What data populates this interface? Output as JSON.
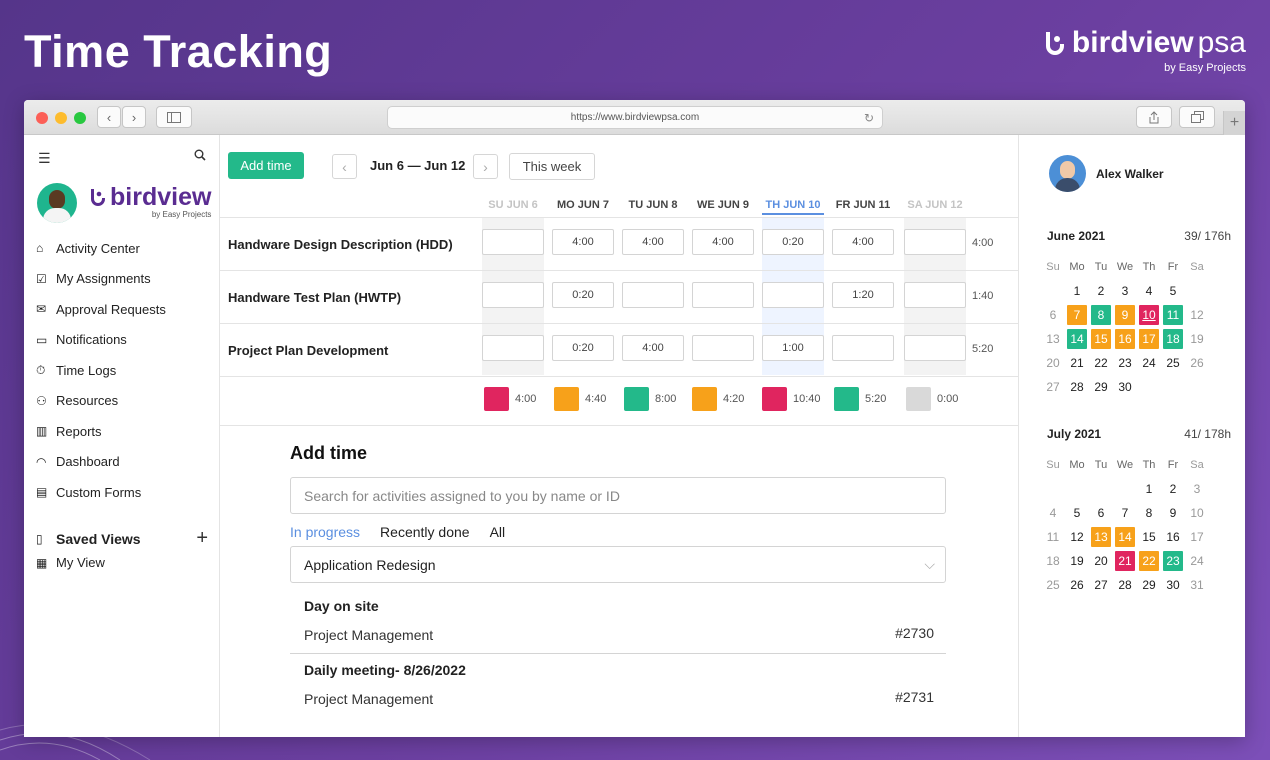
{
  "hero_title": "Time Tracking",
  "brand": {
    "name": "birdview",
    "suffix": "psa",
    "tagline": "by Easy Projects"
  },
  "browser": {
    "url": "https://www.birdviewpsa.com"
  },
  "sidebar": {
    "logo_word": "birdview",
    "logo_sub": "by Easy Projects",
    "nav": [
      {
        "label": "Activity Center",
        "icon": "home-icon"
      },
      {
        "label": "My Assignments",
        "icon": "checkbox-icon"
      },
      {
        "label": "Approval Requests",
        "icon": "approval-icon"
      },
      {
        "label": "Notifications",
        "icon": "chat-icon"
      },
      {
        "label": "Time Logs",
        "icon": "stopwatch-icon"
      },
      {
        "label": "Resources",
        "icon": "person-icon"
      },
      {
        "label": "Reports",
        "icon": "bar-chart-icon"
      },
      {
        "label": "Dashboard",
        "icon": "gauge-icon"
      },
      {
        "label": "Custom Forms",
        "icon": "form-icon"
      }
    ],
    "saved_views_label": "Saved Views",
    "my_view_label": "My View"
  },
  "toolbar": {
    "add_time": "Add time",
    "date_range": "Jun 6 — Jun 12",
    "this_week": "This week"
  },
  "days": [
    {
      "label": "SU JUN 6",
      "state": "off"
    },
    {
      "label": "MO JUN 7",
      "state": "normal"
    },
    {
      "label": "TU JUN 8",
      "state": "normal"
    },
    {
      "label": "WE JUN 9",
      "state": "normal"
    },
    {
      "label": "TH JUN 10",
      "state": "today"
    },
    {
      "label": "FR JUN 11",
      "state": "normal"
    },
    {
      "label": "SA JUN 12",
      "state": "off"
    }
  ],
  "rows": [
    {
      "label": "Handware Design Description (HDD)",
      "cells": [
        "",
        "4:00",
        "4:00",
        "4:00",
        "0:20",
        "4:00",
        ""
      ],
      "total": "4:00"
    },
    {
      "label": "Handware Test Plan (HWTP)",
      "cells": [
        "",
        "0:20",
        "",
        "",
        "",
        "1:20",
        ""
      ],
      "total": "1:40"
    },
    {
      "label": "Project Plan Development",
      "cells": [
        "",
        "0:20",
        "4:00",
        "",
        "1:00",
        "",
        ""
      ],
      "total": "5:20"
    }
  ],
  "totals": [
    {
      "value": "4:00",
      "color": "#e0255f"
    },
    {
      "value": "4:40",
      "color": "#f7a11a"
    },
    {
      "value": "8:00",
      "color": "#23b98a"
    },
    {
      "value": "4:20",
      "color": "#f7a11a"
    },
    {
      "value": "10:40",
      "color": "#e0255f"
    },
    {
      "value": "5:20",
      "color": "#23b98a"
    },
    {
      "value": "0:00",
      "color": "#d9d9d9"
    }
  ],
  "add_panel": {
    "title": "Add time",
    "search_placeholder": "Search for activities assigned to you by name or ID",
    "tabs": [
      "In progress",
      "Recently done",
      "All"
    ],
    "selected_project": "Application Redesign",
    "activities": [
      {
        "title": "Day on site",
        "project": "Project Management",
        "id": "#2730"
      },
      {
        "title": "Daily meeting- 8/26/2022",
        "project": "Project Management",
        "id": "#2731"
      }
    ]
  },
  "user": {
    "name": "Alex Walker"
  },
  "weekday_headers": [
    "Su",
    "Mo",
    "Tu",
    "We",
    "Th",
    "Fr",
    "Sa"
  ],
  "calendars": [
    {
      "month": "June 2021",
      "hours": "39/ 176h",
      "weeks": [
        [
          "",
          "1",
          "2",
          "3",
          "4",
          "5",
          ""
        ],
        [
          "6",
          "7",
          "8",
          "9",
          "10",
          "11",
          "12"
        ],
        [
          "13",
          "14",
          "15",
          "16",
          "17",
          "18",
          "19"
        ],
        [
          "20",
          "21",
          "22",
          "23",
          "24",
          "25",
          "26"
        ],
        [
          "27",
          "28",
          "29",
          "30",
          "",
          "",
          ""
        ]
      ],
      "highlights": {
        "7": "#f7a11a",
        "8": "#23b98a",
        "9": "#f7a11a",
        "10": "#e0255f",
        "11": "#23b98a",
        "14": "#23b98a",
        "15": "#f7a11a",
        "16": "#f7a11a",
        "17": "#f7a11a",
        "18": "#23b98a"
      },
      "underlined": "10"
    },
    {
      "month": "July 2021",
      "hours": "41/ 178h",
      "weeks": [
        [
          "",
          "",
          "",
          "",
          "1",
          "2",
          "3"
        ],
        [
          "4",
          "5",
          "6",
          "7",
          "8",
          "9",
          "10"
        ],
        [
          "11",
          "12",
          "13",
          "14",
          "15",
          "16",
          "17"
        ],
        [
          "18",
          "19",
          "20",
          "21",
          "22",
          "23",
          "24"
        ],
        [
          "25",
          "26",
          "27",
          "28",
          "29",
          "30",
          "31"
        ]
      ],
      "highlights": {
        "13": "#f7a11a",
        "14": "#f7a11a",
        "21": "#e0255f",
        "22": "#f7a11a",
        "23": "#23b98a"
      },
      "underlined": ""
    }
  ]
}
